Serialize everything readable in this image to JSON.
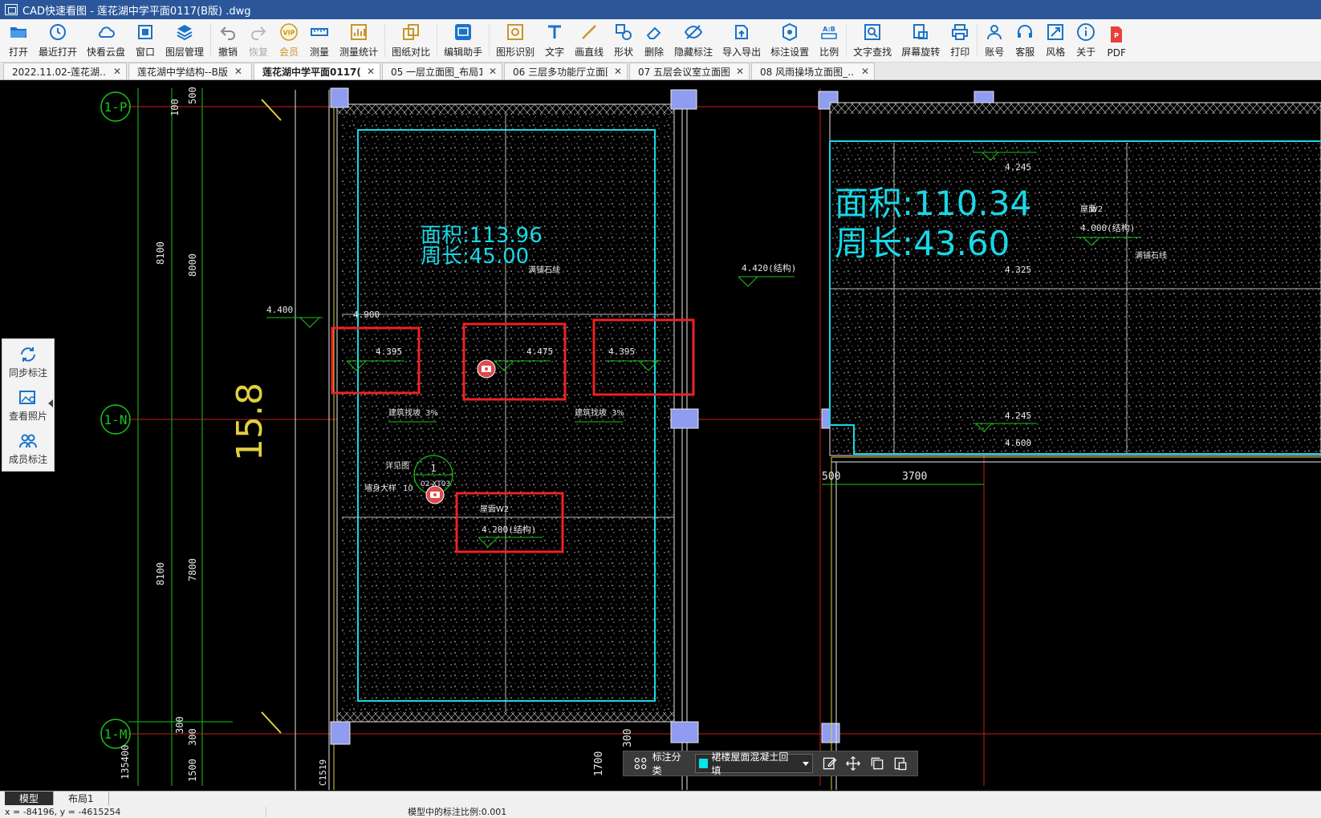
{
  "window": {
    "title": "CAD快速看图 - 莲花湖中学平面0117(B版) .dwg"
  },
  "toolbar": {
    "items": [
      {
        "label": "打开",
        "icon": "folder-open-icon"
      },
      {
        "label": "最近打开",
        "icon": "clock-icon"
      },
      {
        "label": "快看云盘",
        "icon": "cloud-icon"
      },
      {
        "label": "窗口",
        "icon": "window-icon"
      },
      {
        "label": "图层管理",
        "icon": "layers-icon"
      },
      {
        "label": "撤销",
        "icon": "undo-icon"
      },
      {
        "label": "恢复",
        "icon": "redo-icon"
      },
      {
        "label": "会员",
        "icon": "vip-icon"
      },
      {
        "label": "测量",
        "icon": "ruler-icon"
      },
      {
        "label": "测量统计",
        "icon": "measure-stats-icon"
      },
      {
        "label": "图纸对比",
        "icon": "compare-icon"
      },
      {
        "label": "编辑助手",
        "icon": "edit-assistant-icon"
      },
      {
        "label": "图形识别",
        "icon": "shape-recognition-icon"
      },
      {
        "label": "文字",
        "icon": "text-icon"
      },
      {
        "label": "画直线",
        "icon": "line-icon"
      },
      {
        "label": "形状",
        "icon": "shapes-icon"
      },
      {
        "label": "删除",
        "icon": "eraser-icon"
      },
      {
        "label": "隐藏标注",
        "icon": "eye-hide-icon"
      },
      {
        "label": "导入导出",
        "icon": "import-export-icon"
      },
      {
        "label": "标注设置",
        "icon": "annotation-settings-icon"
      },
      {
        "label": "比例",
        "icon": "scale-icon"
      },
      {
        "label": "文字查找",
        "icon": "text-search-icon"
      },
      {
        "label": "屏幕旋转",
        "icon": "rotate-screen-icon"
      },
      {
        "label": "打印",
        "icon": "printer-icon"
      },
      {
        "label": "账号",
        "icon": "user-icon"
      },
      {
        "label": "客服",
        "icon": "headset-icon"
      },
      {
        "label": "风格",
        "icon": "style-icon"
      },
      {
        "label": "关于",
        "icon": "info-icon"
      },
      {
        "label": "PDF",
        "icon": "pdf-icon"
      }
    ],
    "vip_badge": "VIP",
    "compare_badge": "A:B"
  },
  "tabs": [
    {
      "label": "2022.11.02-莲花湖…",
      "active": false
    },
    {
      "label": "莲花湖中学结构--B版",
      "active": false
    },
    {
      "label": "莲花湖中学平面0117(-",
      "active": true
    },
    {
      "label": "05 一层立面图_布局1",
      "active": false
    },
    {
      "label": "06 三层多功能厅立面图",
      "active": false
    },
    {
      "label": "07 五层会议室立面图",
      "active": false
    },
    {
      "label": "08 风雨操场立面图_…",
      "active": false
    }
  ],
  "side_panel": {
    "items": [
      {
        "label": "同步标注",
        "icon": "sync-icon"
      },
      {
        "label": "查看照片",
        "icon": "photo-icon"
      },
      {
        "label": "成员标注",
        "icon": "members-icon"
      }
    ]
  },
  "drawing": {
    "axes": [
      "1-P",
      "1-N",
      "1-M"
    ],
    "dims_left_outer": [
      "8100",
      "8100",
      "135400"
    ],
    "dims_left_inner": [
      "500",
      "8000",
      "7800",
      "300",
      "1500",
      "300"
    ],
    "dim_100": "100",
    "big_number": "15.8",
    "left_area": {
      "area": "面积:113.96",
      "perimeter": "周长:45.00"
    },
    "right_area": {
      "area": "面积:110.34",
      "perimeter": "周长:43.60"
    },
    "levels": [
      "4.395",
      "4.475",
      "4.395",
      "4.900",
      "4.400",
      "4.420(结构)",
      "4.200(结构)",
      "4.245",
      "4.325",
      "4.000(结构)",
      "4.245",
      "4.600"
    ],
    "labels": [
      "满铺石线",
      "建筑找坡",
      "3%",
      "建筑找坡",
      "3%",
      "屋面",
      "W2",
      "详见图",
      "墙身大样",
      "10",
      "02-XT03",
      "1",
      "W2",
      "屋面",
      "满铺石线",
      "C1519"
    ],
    "dims_bottom": [
      "500",
      "3700",
      "1700",
      "300"
    ]
  },
  "annotation_bar": {
    "category_label": "标注分类",
    "category_value": "裙楼屋面混凝土回填",
    "swatch_color": "#00e5ee"
  },
  "layout_tabs": [
    {
      "label": "模型",
      "active": true
    },
    {
      "label": "布局1",
      "active": false
    }
  ],
  "status": {
    "coords": "x = -84196, y = -4615254",
    "scale": "模型中的标注比例:0.001"
  }
}
